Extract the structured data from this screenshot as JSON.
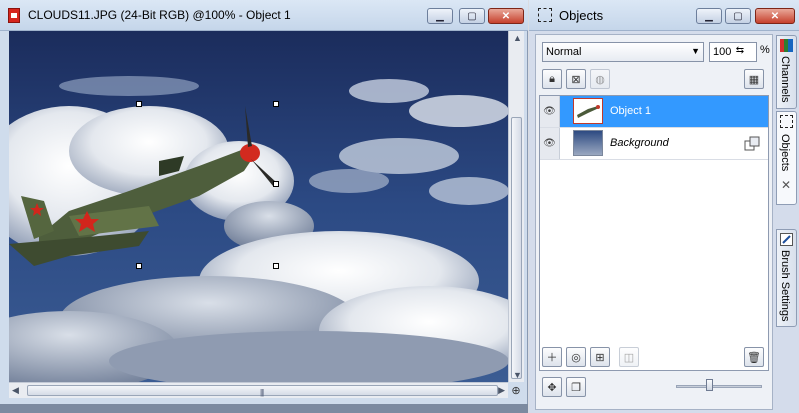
{
  "image_window": {
    "title": "CLOUDS11.JPG (24-Bit RGB) @100% - Object 1",
    "icons": {
      "doc": "document-icon",
      "minimize": "minimize-icon",
      "maximize": "maximize-icon",
      "close": "close-icon",
      "zoom": "zoom-icon"
    },
    "scroll": {
      "vertical_fraction": 0.75,
      "horizontal_fraction": 0.95
    }
  },
  "objects_panel": {
    "title": "Objects",
    "blend_mode": "Normal",
    "opacity": "100",
    "opacity_unit": "%",
    "layers": [
      {
        "name": "Object 1",
        "selected": true
      },
      {
        "name": "Background",
        "selected": false
      }
    ],
    "side_tabs": {
      "channels": "Channels",
      "objects": "Objects",
      "brush_settings": "Brush Settings"
    },
    "tool_buttons": [
      "lock-transparency-icon",
      "mask-icon",
      "combine-icon",
      "object-properties-icon"
    ],
    "bottom_buttons": [
      "new-object-icon",
      "new-lens-icon",
      "new-from-selection-icon",
      "combine-objects-icon",
      "delete-icon",
      "tile-icon",
      "merge-icon"
    ],
    "slider_value": 0.35
  },
  "colors": {
    "selection": "#3399ff",
    "titlebar": "#c5d6ea",
    "close_button": "#c6402c"
  }
}
